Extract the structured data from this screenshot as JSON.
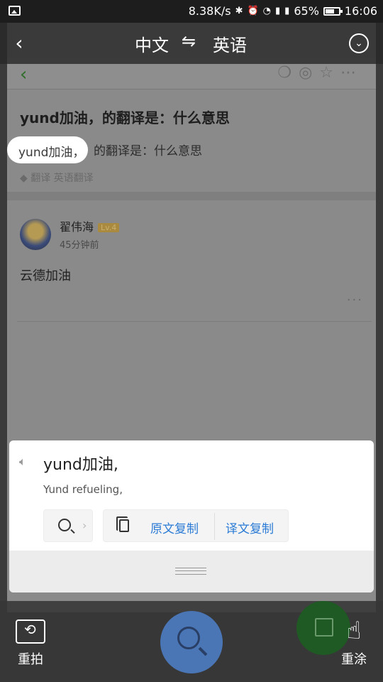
{
  "status_bar": {
    "speed": "8.38K/s",
    "battery_percent": "65%",
    "battery_level": 0.65,
    "time": "16:06",
    "icons": [
      "image-icon",
      "bluetooth-icon",
      "alarm-icon",
      "wifi-icon",
      "signal-icon",
      "signal-icon-2",
      "battery-icon"
    ]
  },
  "translation_header": {
    "source_lang": "中文",
    "swap_symbol": "⇋",
    "target_lang": "英语",
    "back_icon": "back-arrow-icon",
    "menu_icon": "chevron-down-circle-icon"
  },
  "underlying_page": {
    "question_title": "yund加油，的翻译是：什么意思",
    "highlighted_text": "yund加油，",
    "subtitle_rest": "的翻译是：什么意思",
    "tags": "翻译  英语翻译",
    "answer": {
      "username": "翟伟海",
      "level": "Lv.4",
      "time": "45分钟前",
      "content": "云德加油",
      "more": "···"
    }
  },
  "result_card": {
    "source_text": "yund加油,",
    "translated_text": "Yund refueling,",
    "copy_source_label": "原文复制",
    "copy_translation_label": "译文复制"
  },
  "bottom_bar": {
    "retake_label": "重拍",
    "redraw_label": "重涂"
  }
}
